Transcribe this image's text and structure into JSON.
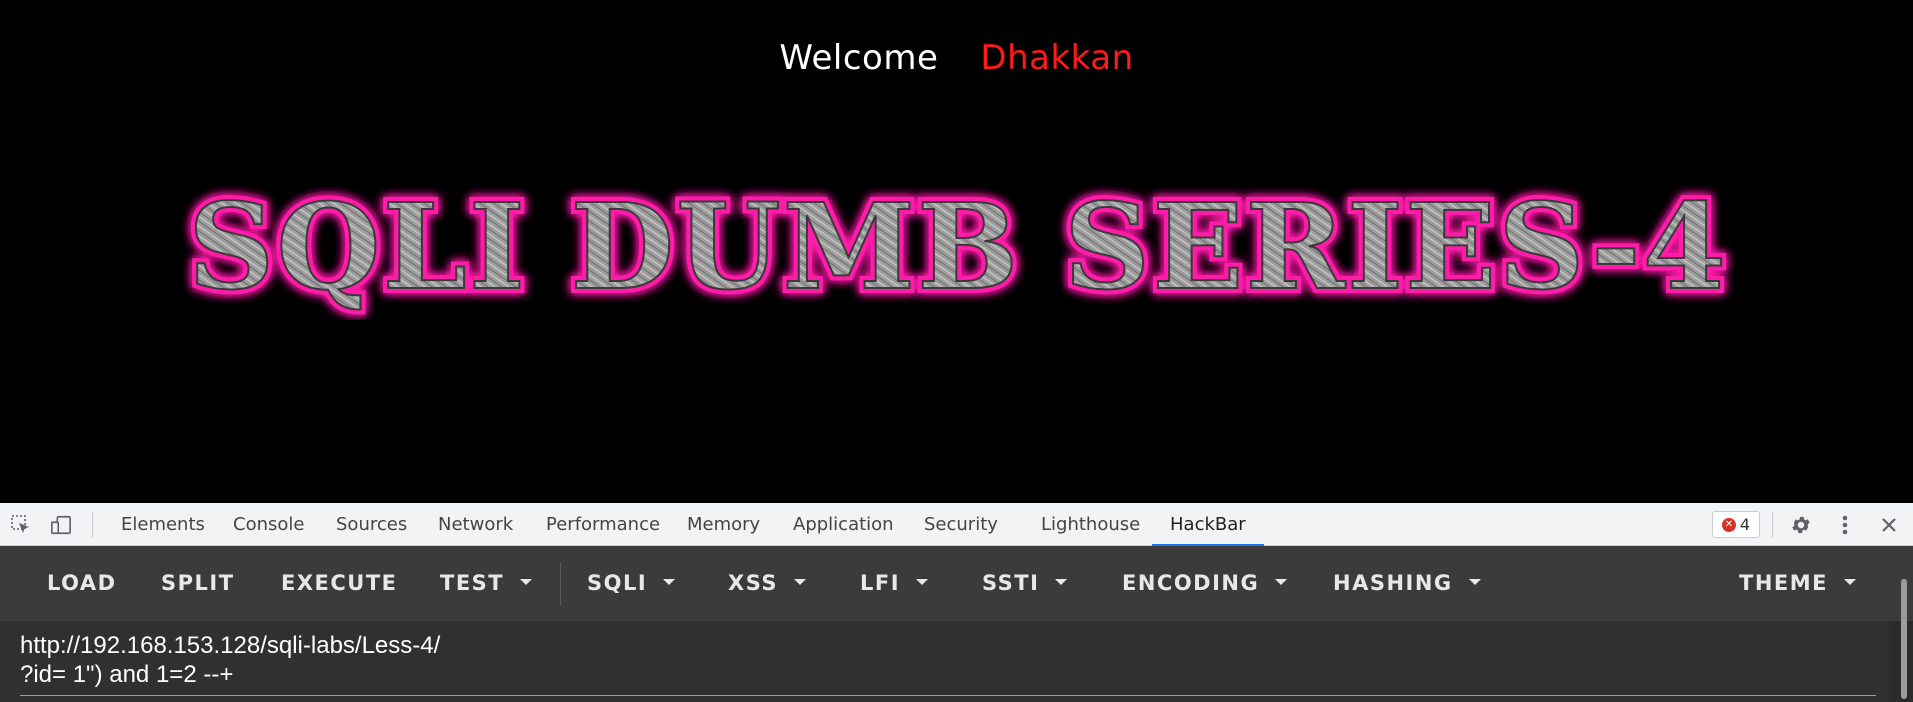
{
  "page": {
    "welcome_label": "Welcome",
    "username": "Dhakkan",
    "banner_title": "SQLI DUMB SERIES-4",
    "colors": {
      "welcome": "#ffffff",
      "username": "#ff1a1a",
      "banner_glow": "#ff1aa8",
      "banner_fill": "#a8a8a8"
    }
  },
  "devtools": {
    "icons": [
      "inspect-element-icon",
      "device-toggle-icon",
      "settings-gear-icon",
      "more-options-icon",
      "close-icon"
    ],
    "tabs": [
      {
        "label": "Elements"
      },
      {
        "label": "Console"
      },
      {
        "label": "Sources"
      },
      {
        "label": "Network"
      },
      {
        "label": "Performance"
      },
      {
        "label": "Memory"
      },
      {
        "label": "Application"
      },
      {
        "label": "Security"
      },
      {
        "label": "Lighthouse"
      },
      {
        "label": "HackBar",
        "active": true
      }
    ],
    "error_count": "4"
  },
  "hackbar": {
    "buttons": {
      "load": "LOAD",
      "split": "SPLIT",
      "execute": "EXECUTE",
      "test": "TEST",
      "sqli": "SQLI",
      "xss": "XSS",
      "lfi": "LFI",
      "ssti": "SSTI",
      "encoding": "ENCODING",
      "hashing": "HASHING",
      "theme": "THEME"
    },
    "url_value": "http://192.168.153.128/sqli-labs/Less-4/\n?id= 1\") and 1=2 --+"
  }
}
